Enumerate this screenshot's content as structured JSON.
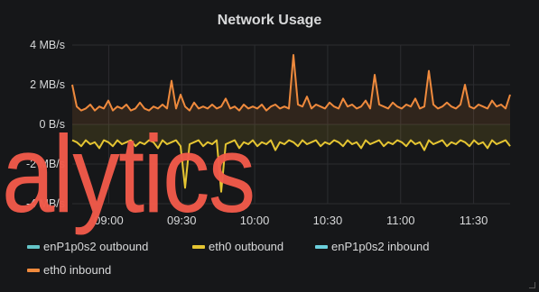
{
  "panel": {
    "title": "Network Usage",
    "overlay_text": "alytics"
  },
  "legend": [
    {
      "label": "enP1p0s2 outbound",
      "color": "#64c5c8"
    },
    {
      "label": "eth0 outbound",
      "color": "#e5c532"
    },
    {
      "label": "enP1p0s2 inbound",
      "color": "#6bd0dc"
    },
    {
      "label": "eth0 inbound",
      "color": "#ef8a3d"
    }
  ],
  "chart_data": {
    "type": "line",
    "title": "Network Usage",
    "y_unit": "MB/s",
    "ylim": [
      -4,
      4
    ],
    "y_ticks": [
      "4 MB/s",
      "2 MB/s",
      "0 B/s",
      "-2 MB/s",
      "-4 MB/s"
    ],
    "x_ticks": [
      "09:00",
      "09:30",
      "10:00",
      "10:30",
      "11:00",
      "11:30"
    ],
    "grid": true,
    "legend_position": "bottom",
    "series": [
      {
        "name": "eth0 inbound",
        "color": "#ef8a3d",
        "x_range": [
          "08:45",
          "11:45"
        ],
        "values": [
          2.0,
          0.9,
          0.7,
          0.8,
          1.0,
          0.7,
          0.9,
          0.8,
          1.2,
          0.7,
          0.9,
          0.8,
          1.0,
          0.7,
          0.8,
          1.1,
          0.8,
          0.7,
          0.9,
          0.8,
          1.0,
          0.8,
          2.2,
          0.8,
          1.5,
          0.9,
          0.7,
          1.1,
          0.8,
          0.9,
          0.8,
          1.0,
          0.8,
          0.9,
          1.3,
          0.8,
          0.9,
          0.7,
          1.0,
          0.8,
          0.9,
          0.8,
          1.0,
          0.7,
          0.9,
          1.0,
          0.8,
          0.9,
          0.8,
          3.5,
          1.0,
          0.9,
          1.4,
          0.8,
          1.0,
          0.9,
          0.8,
          1.1,
          0.9,
          0.8,
          1.3,
          0.9,
          1.0,
          0.8,
          0.9,
          1.2,
          0.8,
          2.5,
          1.0,
          0.9,
          0.8,
          1.1,
          0.9,
          0.8,
          1.0,
          0.9,
          1.3,
          0.8,
          0.9,
          2.7,
          1.0,
          0.8,
          0.9,
          1.1,
          0.9,
          0.8,
          1.0,
          2.0,
          0.9,
          0.8,
          1.0,
          0.9,
          0.8,
          1.2,
          0.9,
          1.0,
          0.8,
          1.5
        ]
      },
      {
        "name": "eth0 outbound",
        "color": "#e5c532",
        "x_range": [
          "08:45",
          "11:45"
        ],
        "values": [
          -0.8,
          -0.9,
          -1.1,
          -0.8,
          -1.0,
          -0.9,
          -1.2,
          -0.8,
          -0.9,
          -1.1,
          -0.8,
          -1.0,
          -0.9,
          -0.8,
          -1.1,
          -0.9,
          -1.0,
          -0.8,
          -0.9,
          -1.2,
          -0.8,
          -1.0,
          -0.9,
          -0.8,
          -1.1,
          -3.2,
          -1.0,
          -0.9,
          -0.8,
          -1.1,
          -0.9,
          -1.0,
          -0.8,
          -3.4,
          -1.0,
          -0.9,
          -0.8,
          -1.2,
          -0.9,
          -1.0,
          -0.8,
          -1.1,
          -0.9,
          -1.0,
          -0.8,
          -1.3,
          -0.9,
          -1.0,
          -0.8,
          -0.9,
          -1.1,
          -0.8,
          -1.0,
          -0.9,
          -0.8,
          -1.1,
          -0.9,
          -1.0,
          -0.8,
          -0.9,
          -1.1,
          -0.8,
          -1.0,
          -0.9,
          -1.2,
          -0.8,
          -1.0,
          -0.9,
          -0.8,
          -1.1,
          -0.9,
          -1.0,
          -0.8,
          -0.9,
          -1.1,
          -0.8,
          -1.0,
          -0.9,
          -1.3,
          -0.8,
          -1.0,
          -0.9,
          -0.8,
          -1.1,
          -0.9,
          -1.0,
          -0.8,
          -0.9,
          -1.1,
          -0.8,
          -1.0,
          -0.9,
          -1.2,
          -0.8,
          -1.0,
          -0.9,
          -0.8,
          -1.1
        ]
      }
    ]
  }
}
